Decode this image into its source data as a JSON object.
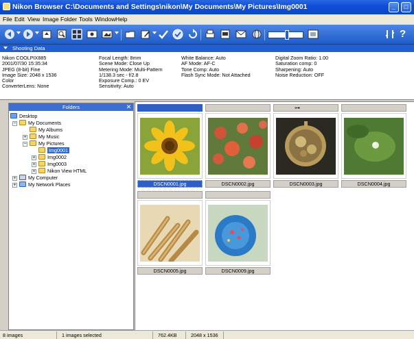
{
  "window": {
    "title": "Nikon Browser C:\\Documents and Settings\\nikon\\My Documents\\My Pictures\\Img0001"
  },
  "menu": [
    "File",
    "Edit",
    "View",
    "Image",
    "Folder",
    "Tools",
    "Window",
    "Help"
  ],
  "shooting": {
    "header": "Shooting Data",
    "col1": [
      "Nikon COOLPIX885",
      "2001/07/30 15:35:34",
      "JPEG (8-bit) Fine",
      "Image Size:  2048 x 1536",
      "Color",
      "ConverterLens: None"
    ],
    "col2": [
      "Focal Length: 8mm",
      "Scene Mode: Close Up",
      "Metering Mode: Multi-Pattern",
      "1/138.3 sec - f/2.8",
      "Exposure Comp.: 0 EV",
      "Sensitivity: Auto"
    ],
    "col3": [
      "White Balance: Auto",
      "AF Mode: AF-C",
      "Tone Comp: Auto",
      "Flash Sync Mode: Not Attached"
    ],
    "col4": [
      "Digital Zoom Ratio: 1.00",
      "Saturation comp: 0",
      "Sharpening: Auto",
      "Noise Reduction: OFF"
    ]
  },
  "folders": {
    "header": "Folders",
    "tree": [
      "Desktop",
      "My Documents",
      "My Albums",
      "My Music",
      "My Pictures",
      "Img0001",
      "Img0002",
      "Img0003",
      "Nikon View HTML",
      "My Computer",
      "My Network Places"
    ]
  },
  "thumbs": [
    {
      "name": "DSCN0001.jpg",
      "subject": "sunflower"
    },
    {
      "name": "DSCN0002.jpg",
      "subject": "flowers"
    },
    {
      "name": "DSCN0003.jpg",
      "subject": "pocket-watch"
    },
    {
      "name": "DSCN0004.jpg",
      "subject": "leaf"
    },
    {
      "name": "DSCN0005.jpg",
      "subject": "wheat"
    },
    {
      "name": "DSCN0009.jpg",
      "subject": "blue-flower"
    }
  ],
  "status": {
    "count": "8 images",
    "selected": "1 images selected",
    "size": "762.4KB",
    "dims": "2048 x 1536"
  },
  "colors": {
    "titlebar": "#0b46c9",
    "toolbar": "#1e5cc8",
    "selection": "#316ac5"
  }
}
